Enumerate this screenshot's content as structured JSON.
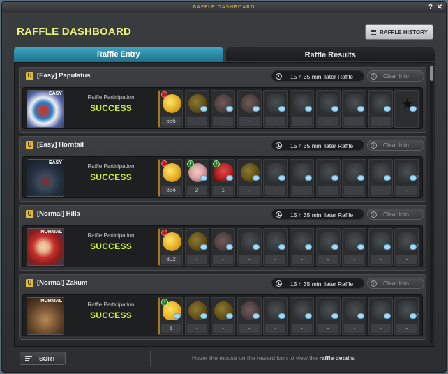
{
  "window": {
    "title_small": "RAFFLE DASHBOARD",
    "help_label": "?",
    "close_label": "✕"
  },
  "header": {
    "title": "RAFFLE DASHBOARD",
    "history_button": "RAFFLE HISTORY"
  },
  "tabs": [
    {
      "label": "Raffle Entry",
      "active": true
    },
    {
      "label": "Raffle Results",
      "active": false
    }
  ],
  "bosses": [
    {
      "icon_label": "U",
      "name": "[Easy] Papulatus",
      "difficulty_tag": "EASY",
      "timer": "15 h 35 min. later Raffle",
      "clear_info": "Clear Info",
      "participation_label": "Raffle Participation",
      "participation_status": "SUCCESS",
      "rewards": [
        {
          "icon": "coin-icon",
          "count": "686"
        },
        {
          "icon": "coin-dim-icon",
          "count": "-"
        },
        {
          "icon": "orb-dim-icon",
          "count": "-"
        },
        {
          "icon": "ring-dim-icon",
          "count": "-"
        },
        {
          "icon": "item-dim-icon",
          "count": "-"
        },
        {
          "icon": "item-dim-icon",
          "count": "-"
        },
        {
          "icon": "item-dim-icon",
          "count": "-"
        },
        {
          "icon": "item-dim-icon",
          "count": "-"
        },
        {
          "icon": "item-dim-icon",
          "count": "-"
        },
        {
          "icon": "star-icon",
          "count": ""
        }
      ]
    },
    {
      "icon_label": "U",
      "name": "[Easy] Horntail",
      "difficulty_tag": "EASY",
      "timer": "15 h 35 min. later Raffle",
      "clear_info": "Clear Info",
      "participation_label": "Raffle Participation",
      "participation_status": "SUCCESS",
      "rewards": [
        {
          "icon": "coin-icon",
          "count": "884"
        },
        {
          "icon": "orb-icon",
          "count": "2"
        },
        {
          "icon": "helmet-icon",
          "count": "1"
        },
        {
          "icon": "coin-dim-icon",
          "count": "-"
        },
        {
          "icon": "item-dim-icon",
          "count": "-"
        },
        {
          "icon": "item-dim-icon",
          "count": "-"
        },
        {
          "icon": "item-dim-icon",
          "count": "-"
        },
        {
          "icon": "item-dim-icon",
          "count": "-"
        },
        {
          "icon": "item-dim-icon",
          "count": "-"
        },
        {
          "icon": "item-dim-icon",
          "count": "-"
        }
      ]
    },
    {
      "icon_label": "U",
      "name": "[Normal] Hilla",
      "difficulty_tag": "NORMAL",
      "timer": "15 h 35 min. later Raffle",
      "clear_info": "Clear Info",
      "participation_label": "Raffle Participation",
      "participation_status": "SUCCESS",
      "rewards": [
        {
          "icon": "coin-icon",
          "count": "802"
        },
        {
          "icon": "coin-dim-icon",
          "count": "-"
        },
        {
          "icon": "orb-dim-icon",
          "count": "-"
        },
        {
          "icon": "item-dim-icon",
          "count": "-"
        },
        {
          "icon": "item-dim-icon",
          "count": "-"
        },
        {
          "icon": "item-dim-icon",
          "count": "-"
        },
        {
          "icon": "item-dim-icon",
          "count": "-"
        },
        {
          "icon": "item-dim-icon",
          "count": "-"
        },
        {
          "icon": "item-dim-icon",
          "count": "-"
        },
        {
          "icon": "item-dim-icon",
          "count": "-"
        }
      ]
    },
    {
      "icon_label": "U",
      "name": "[Normal] Zakum",
      "difficulty_tag": "NORMAL",
      "timer": "15 h 35 min. later Raffle",
      "clear_info": "Clear Info",
      "participation_label": "Raffle Participation",
      "participation_status": "SUCCESS",
      "rewards": [
        {
          "icon": "cloud-coin-icon",
          "count": "1"
        },
        {
          "icon": "coin-dim-icon",
          "count": "-"
        },
        {
          "icon": "coin-dim-icon",
          "count": "-"
        },
        {
          "icon": "orb-dim-icon",
          "count": "-"
        },
        {
          "icon": "item-dim-icon",
          "count": "-"
        },
        {
          "icon": "item-dim-icon",
          "count": "-"
        },
        {
          "icon": "item-dim-icon",
          "count": "-"
        },
        {
          "icon": "item-dim-icon",
          "count": "-"
        },
        {
          "icon": "item-dim-icon",
          "count": "-"
        },
        {
          "icon": "item-dim-icon",
          "count": "-"
        }
      ]
    }
  ],
  "footer": {
    "sort_label": "SORT",
    "hint_prefix": "Hover the mouse on the reward icon to view the",
    "hint_bold": "raffle details",
    "hint_suffix": "."
  },
  "colors": {
    "title": "#e6f47a",
    "success": "#c8f03a",
    "active_tab": "#2a8fae"
  }
}
